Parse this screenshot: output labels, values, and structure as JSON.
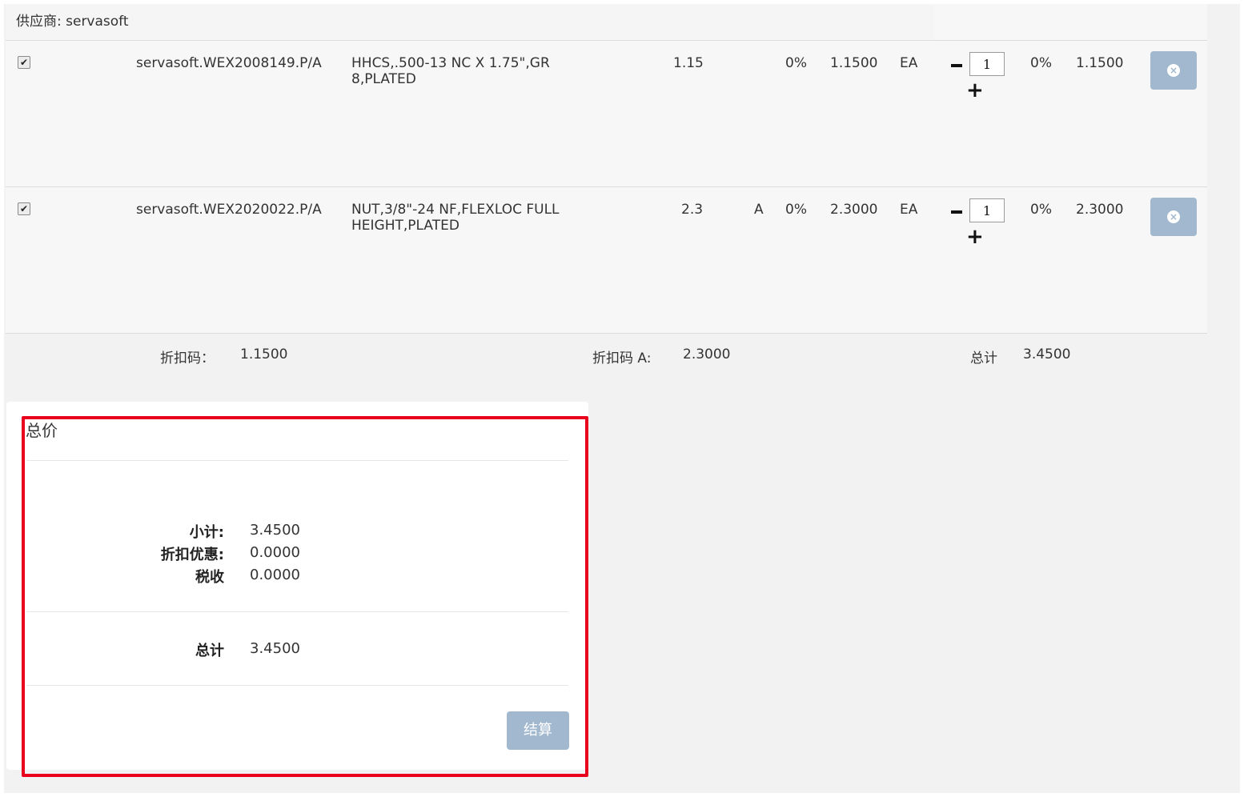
{
  "vendor": {
    "label": "供应商: servasoft"
  },
  "items": [
    {
      "checked": "✔",
      "part": "servasoft.WEX2008149.P/A",
      "description": "HHCS,.500-13 NC X 1.75\",GR 8,PLATED",
      "price": "1.15",
      "discount_code": "",
      "discount_pct": "0%",
      "unit_price": "1.1500",
      "unit": "EA",
      "qty": "1",
      "tax_pct": "0%",
      "line_total": "1.1500"
    },
    {
      "checked": "✔",
      "part": "servasoft.WEX2020022.P/A",
      "description": "NUT,3/8\"-24 NF,FLEXLOC FULL HEIGHT,PLATED",
      "price": "2.3",
      "discount_code": "A",
      "discount_pct": "0%",
      "unit_price": "2.3000",
      "unit": "EA",
      "qty": "1",
      "tax_pct": "0%",
      "line_total": "2.3000"
    }
  ],
  "summary_row": {
    "discount_code_label": "折扣码：",
    "discount_code_value": "1.1500",
    "discount_code_a_label": "折扣码 A:",
    "discount_code_a_value": "2.3000",
    "total_label": "总计",
    "total_value": "3.4500"
  },
  "totals_panel": {
    "title": "总价",
    "subtotal_label": "小计:",
    "subtotal_value": "3.4500",
    "discount_label": "折扣优惠:",
    "discount_value": "0.0000",
    "tax_label": "税收",
    "tax_value": "0.0000",
    "total_label": "总计",
    "total_value": "3.4500",
    "checkout_label": "结算"
  },
  "icons": {
    "minus": "minus-icon",
    "plus": "plus-icon",
    "remove": "remove-icon"
  },
  "colors": {
    "button": "#a1b8cf",
    "highlight": "#e8001c"
  }
}
